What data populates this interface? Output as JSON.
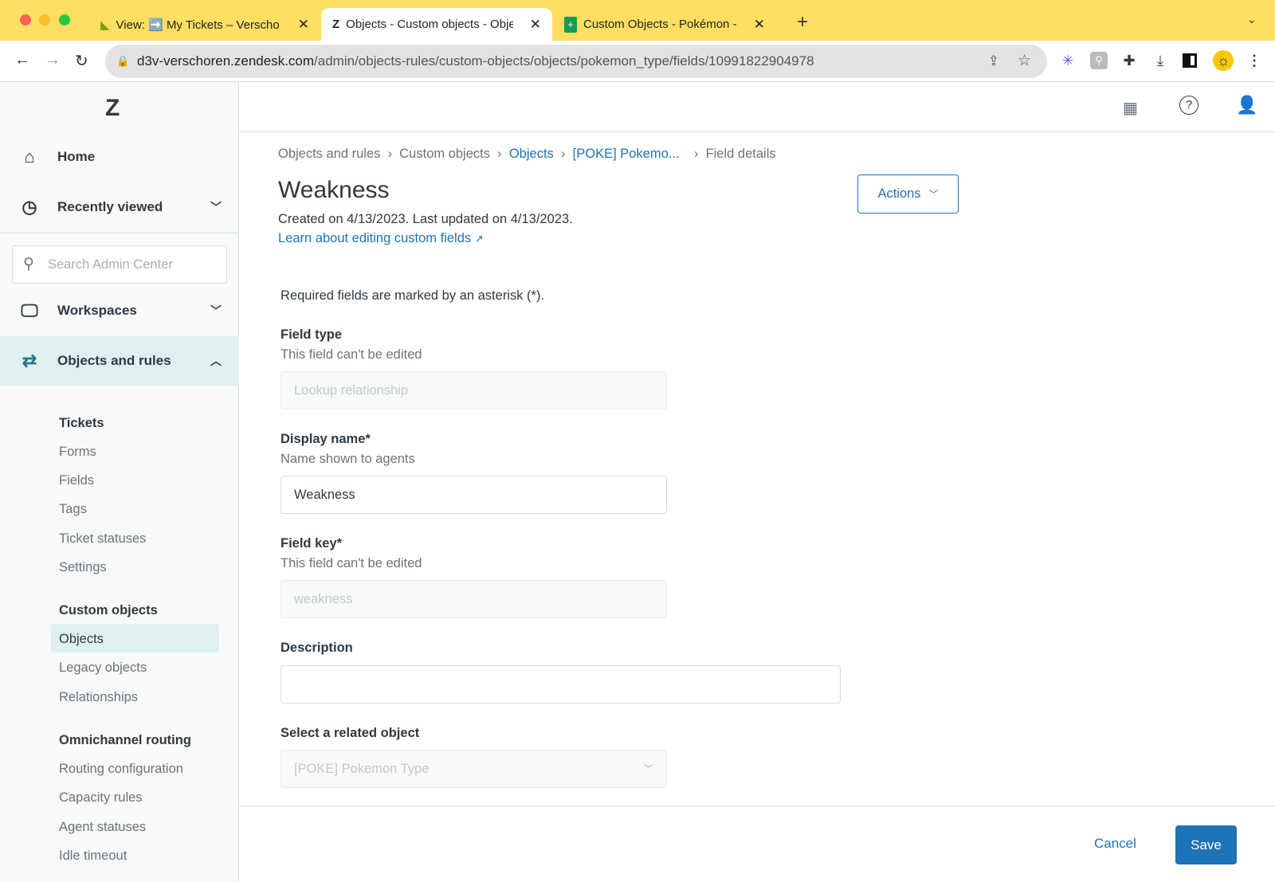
{
  "browser": {
    "tabs": [
      {
        "title": "View: ➡️ My Tickets – Verschoren",
        "icon": "zendesk-support-icon"
      },
      {
        "title": "Objects - Custom objects - Objects",
        "icon": "zendesk-icon",
        "active": true
      },
      {
        "title": "Custom Objects - Pokémon - Google Sheets",
        "icon": "google-sheets-icon"
      }
    ],
    "url_host": "d3v-verschoren.zendesk.com",
    "url_path": "/admin/objects-rules/custom-objects/objects/pokemon_type/fields/10991822904978"
  },
  "sidebar": {
    "home": "Home",
    "recently_viewed": "Recently viewed",
    "search_placeholder": "Search Admin Center",
    "workspaces": "Workspaces",
    "objects_and_rules": "Objects and rules",
    "groups": [
      {
        "heading": "Tickets",
        "items": [
          "Forms",
          "Fields",
          "Tags",
          "Ticket statuses",
          "Settings"
        ]
      },
      {
        "heading": "Custom objects",
        "items": [
          "Objects",
          "Legacy objects",
          "Relationships"
        ]
      },
      {
        "heading": "Omnichannel routing",
        "items": [
          "Routing configuration",
          "Capacity rules",
          "Agent statuses",
          "Idle timeout"
        ]
      }
    ],
    "selected": "Objects",
    "accent": "#def1f0"
  },
  "breadcrumb": [
    "Objects and rules",
    "Custom objects",
    "Objects",
    "[POKE] Pokemo...",
    "Field details"
  ],
  "page": {
    "title": "Weakness",
    "meta": "Created on 4/13/2023. Last updated on 4/13/2023.",
    "learn_link": "Learn about editing custom fields",
    "actions": "Actions",
    "required_note": "Required fields are marked by an asterisk (*)."
  },
  "form": {
    "field_type": {
      "label": "Field type",
      "hint": "This field can't be edited",
      "value": "Lookup relationship"
    },
    "display_name": {
      "label": "Display name*",
      "hint": "Name shown to agents",
      "value": "Weakness"
    },
    "field_key": {
      "label": "Field key*",
      "hint": "This field can't be edited",
      "value": "weakness"
    },
    "description": {
      "label": "Description",
      "value": ""
    },
    "related_object": {
      "label": "Select a related object",
      "value": "[POKE] Pokemon Type"
    }
  },
  "footer": {
    "cancel": "Cancel",
    "save": "Save",
    "primary_color": "#1f73b7"
  }
}
